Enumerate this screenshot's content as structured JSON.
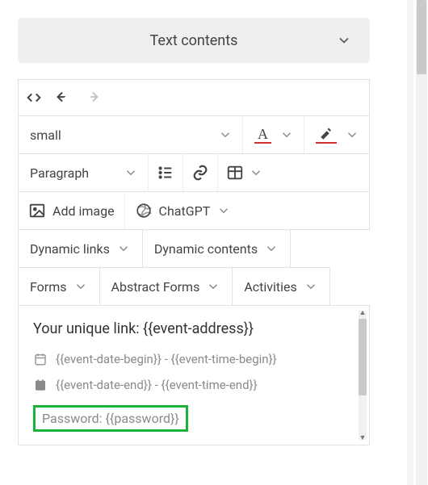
{
  "header": {
    "title": "Text contents"
  },
  "font_size_select": {
    "value": "small"
  },
  "block_select": {
    "value": "Paragraph"
  },
  "add_image_button": "Add image",
  "chatgpt_button": "ChatGPT",
  "chips_row1": {
    "dynamic_links": "Dynamic links",
    "dynamic_contents": "Dynamic contents"
  },
  "chips_row2": {
    "forms": "Forms",
    "abstract_forms": "Abstract Forms",
    "activities": "Activities"
  },
  "preview": {
    "unique_link_label": "Your unique link:",
    "unique_link_token": "{{event-address}}",
    "date_begin": "{{event-date-begin}}",
    "time_begin": "{{event-time-begin}}",
    "date_end": "{{event-date-end}}",
    "time_end": "{{event-time-end}}",
    "password_label": "Password:",
    "password_token": "{{password}}",
    "separator": " - "
  },
  "colors": {
    "highlight_border": "#18b23a"
  }
}
